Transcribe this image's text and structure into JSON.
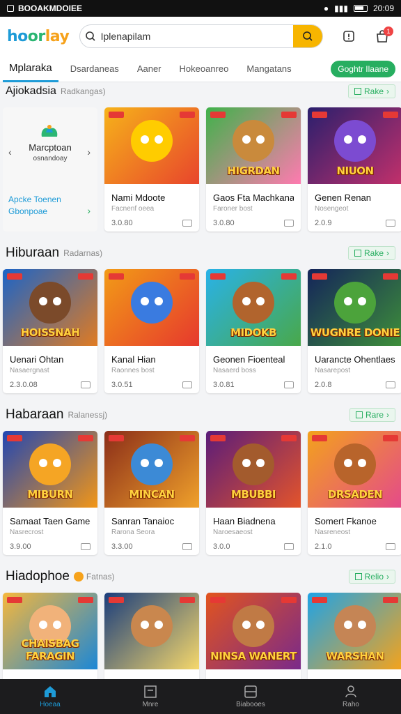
{
  "status": {
    "left_text": "BOOAKMDOIEE",
    "time": "20:09"
  },
  "header": {
    "logo": [
      "ho",
      "or",
      "lay"
    ],
    "search_value": "Iplenapilam",
    "badge": "1"
  },
  "tabs": [
    {
      "label": "Mplaraka",
      "active": true
    },
    {
      "label": "Dsardaneas"
    },
    {
      "label": "Aaner"
    },
    {
      "label": "Hokeoanreo"
    },
    {
      "label": "Mangatans"
    }
  ],
  "tab_cta": "Goghtr Ilaane",
  "sections": [
    {
      "title": "Ajiokadsia",
      "sub": "Radkangas)",
      "more": "Rake",
      "promo": {
        "brand": "Marcptoan",
        "brand_sub": "osnandoay",
        "cta_line1": "Apcke Toenen",
        "cta_line2": "Gbonpoae"
      },
      "cards": [
        {
          "art": "",
          "name": "Nami Mdoote",
          "meta": "Facnenf oeea",
          "price": "3.0.80",
          "bg": [
            "#f6b21a",
            "#e8452c"
          ],
          "face": "#ffcc00"
        },
        {
          "art": "HIGRDAN",
          "name": "Gaos Fta Machkanan",
          "meta": "Faroner bost",
          "price": "3.0.80",
          "bg": [
            "#3fb24a",
            "#ff7ab0"
          ],
          "face": "#c98a3c"
        },
        {
          "art": "NIUON",
          "name": "Genen Renan",
          "meta": "Nosengeot",
          "price": "2.0.9",
          "bg": [
            "#2a1f6d",
            "#c2306b"
          ],
          "face": "#7c4bd1"
        }
      ]
    },
    {
      "title": "Hiburaan",
      "sub": "Radarnas)",
      "more": "Rake",
      "cards": [
        {
          "art": "HOISSNAH",
          "name": "Uenari Ohtan",
          "meta": "Nasaergnast",
          "price": "2.3.0.08",
          "bg": [
            "#1b64c8",
            "#e07b22"
          ],
          "face": "#7b4a2a"
        },
        {
          "art": "",
          "name": "Kanal Hian",
          "meta": "Raonnes bost",
          "price": "3.0.51",
          "bg": [
            "#f29b17",
            "#e6392d"
          ],
          "face": "#3a7be0"
        },
        {
          "art": "MIDOKB",
          "name": "Geonen Fioenteal",
          "meta": "Nasaerd boss",
          "price": "3.0.81",
          "bg": [
            "#29b2e8",
            "#49a84a"
          ],
          "face": "#b1642d"
        },
        {
          "art": "WUGNRE DONIE",
          "name": "Uarancte Ohentlaes",
          "meta": "Nasarepost",
          "price": "2.0.8",
          "bg": [
            "#14245a",
            "#3e8f3a"
          ],
          "face": "#4ca33b"
        }
      ]
    },
    {
      "title": "Habaraan",
      "sub": "Ralanessj)",
      "more": "Rare",
      "cards": [
        {
          "art": "MIBURN",
          "name": "Samaat Taen Gameg",
          "meta": "Nasrecrost",
          "price": "3.9.00",
          "bg": [
            "#2046b4",
            "#f29617"
          ],
          "face": "#f5a524"
        },
        {
          "art": "MINCAN",
          "name": "Sanran Tanaioc",
          "meta": "Rarona Seora",
          "price": "3.3.00",
          "bg": [
            "#8a2d19",
            "#f0a12b"
          ],
          "face": "#3c8ad6"
        },
        {
          "art": "MBUBBI",
          "name": "Haan Biadnena",
          "meta": "Naroesaeost",
          "price": "3.0.0",
          "bg": [
            "#5a1c7a",
            "#e3542b"
          ],
          "face": "#a35b2d"
        },
        {
          "art": "DRSADEN",
          "name": "Somert Fkanoe",
          "meta": "Nasreneost",
          "price": "2.1.0",
          "bg": [
            "#f3a21c",
            "#e44a8a"
          ],
          "face": "#b8642b"
        }
      ]
    },
    {
      "title": "Hiadophoe",
      "sub": "Fatnas)",
      "more": "Relio",
      "cards": [
        {
          "art": "CHAISBAG FARAGIN",
          "bg": [
            "#f6b73c",
            "#1b87d6"
          ],
          "face": "#f1b27a"
        },
        {
          "art": "",
          "bg": [
            "#1a3d7c",
            "#f6d86b"
          ],
          "face": "#c9874e"
        },
        {
          "art": "NINSA WANERT",
          "bg": [
            "#e2541e",
            "#7a2a8a"
          ],
          "face": "#c07a45"
        },
        {
          "art": "WARSHAN",
          "bg": [
            "#1fa3e6",
            "#f4a31c"
          ],
          "face": "#c58555"
        }
      ]
    }
  ],
  "bottom_nav": [
    {
      "label": "Hoeaa",
      "active": true
    },
    {
      "label": "Mnre"
    },
    {
      "label": "Biabooes"
    },
    {
      "label": "Raho"
    }
  ],
  "colors": {
    "accent": "#1e9bd7",
    "green": "#27ae60",
    "search_btn": "#f7b500"
  }
}
